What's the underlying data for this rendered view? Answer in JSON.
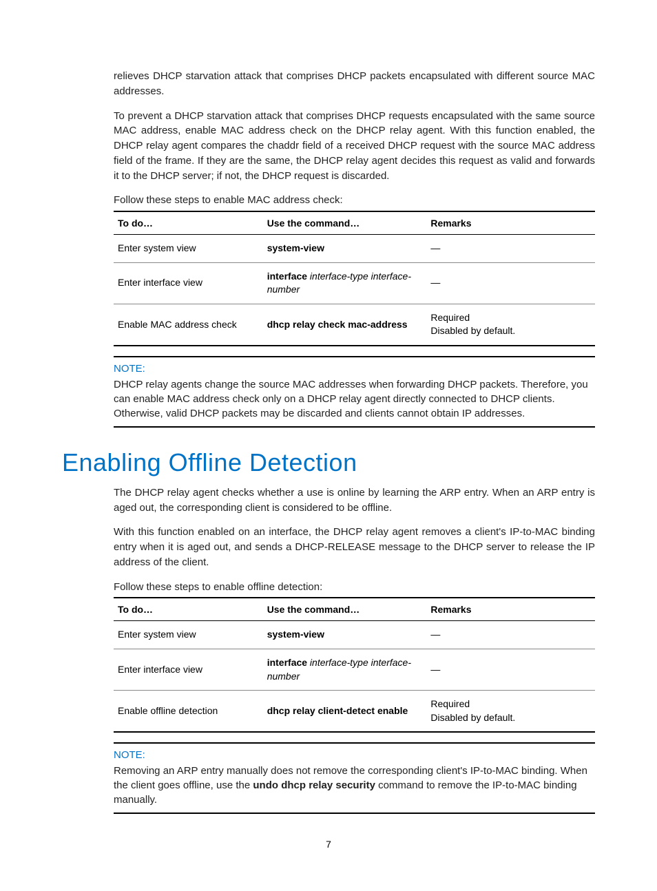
{
  "para1": "relieves DHCP starvation attack that comprises DHCP packets encapsulated with different source MAC addresses.",
  "para2": "To prevent a DHCP starvation attack that comprises DHCP requests encapsulated with the same source MAC address, enable MAC address check on the DHCP relay agent. With this function enabled, the DHCP relay agent compares the chaddr field of a received DHCP request with the source MAC address field of the frame. If they are the same, the DHCP relay agent decides this request as valid and forwards it to the DHCP server; if not, the DHCP request is discarded.",
  "steps1": "Follow these steps to enable MAC address check:",
  "table1": {
    "headers": {
      "c1": "To do…",
      "c2": "Use the command…",
      "c3": "Remarks"
    },
    "rows": [
      {
        "c1": "Enter system view",
        "c2_bold": "system-view",
        "c2_ital": "",
        "c3": "—"
      },
      {
        "c1": "Enter interface view",
        "c2_bold": "interface",
        "c2_ital": " interface-type interface-number",
        "c3": "—"
      },
      {
        "c1": "Enable MAC address check",
        "c2_bold": "dhcp relay check mac-address",
        "c2_ital": "",
        "c3": "Required\nDisabled by default."
      }
    ]
  },
  "note1": {
    "title": "NOTE:",
    "body": "DHCP relay agents change the source MAC addresses when forwarding DHCP packets. Therefore, you can enable MAC address check only on a DHCP relay agent directly connected to DHCP clients. Otherwise, valid DHCP packets may be discarded and clients cannot obtain IP addresses."
  },
  "heading": "Enabling Offline Detection",
  "para3": "The DHCP relay agent checks whether a use is online by learning the ARP entry. When an ARP entry is aged out, the corresponding client is considered to be offline.",
  "para4": "With this function enabled on an interface, the DHCP relay agent removes a client's IP-to-MAC binding entry when it is aged out, and sends a DHCP-RELEASE message to the DHCP server to release the IP address of the client.",
  "steps2": "Follow these steps to enable offline detection:",
  "table2": {
    "headers": {
      "c1": "To do…",
      "c2": "Use the command…",
      "c3": "Remarks"
    },
    "rows": [
      {
        "c1": "Enter system view",
        "c2_bold": "system-view",
        "c2_ital": "",
        "c3": "—"
      },
      {
        "c1": "Enter interface view",
        "c2_bold": "interface",
        "c2_ital": " interface-type interface-number",
        "c3": "—"
      },
      {
        "c1": "Enable offline detection",
        "c2_bold": "dhcp relay client-detect enable",
        "c2_ital": "",
        "c3": "Required\nDisabled by default."
      }
    ]
  },
  "note2": {
    "title": "NOTE:",
    "body_pre": "Removing an ARP entry manually does not remove the corresponding client's IP-to-MAC binding. When the client goes offline, use the ",
    "body_bold": "undo dhcp relay security",
    "body_post": " command to remove the IP-to-MAC binding manually."
  },
  "page_number": "7"
}
